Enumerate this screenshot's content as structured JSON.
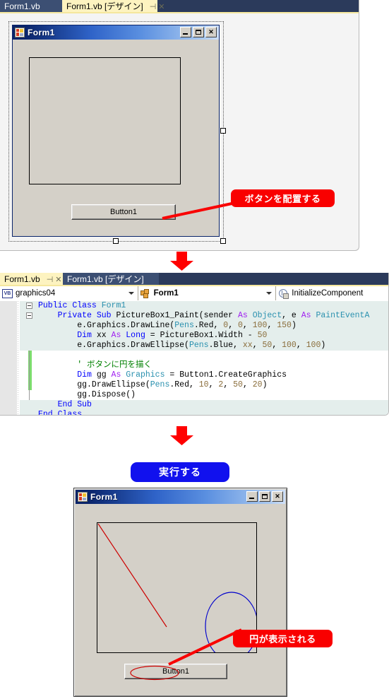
{
  "designer": {
    "tabs": [
      {
        "label": "Form1.vb",
        "active": false,
        "icons": []
      },
      {
        "label": "Form1.vb [デザイン]",
        "active": true,
        "icons": [
          "pin-icon",
          "close-icon"
        ]
      }
    ],
    "form": {
      "title": "Form1",
      "icon": "vb-form-icon",
      "window_buttons": [
        "minimize",
        "maximize",
        "close"
      ],
      "picturebox_name": "PictureBox1",
      "button_label": "Button1"
    },
    "callout": {
      "text": "ボタンを配置する",
      "color": "#f90000"
    }
  },
  "arrows": {
    "color": "#ff0000",
    "glyph": "down-arrow"
  },
  "editor": {
    "tabs": [
      {
        "label": "Form1.vb",
        "active": true,
        "icons": [
          "pin-icon",
          "close-icon"
        ]
      },
      {
        "label": "Form1.vb [デザイン]",
        "active": false,
        "icons": []
      }
    ],
    "dropdowns": [
      {
        "icon": "vb-project-icon",
        "icon_text": "VB",
        "value": "graphics04"
      },
      {
        "icon": "class-icon",
        "value": "Form1"
      },
      {
        "icon": "method-private-icon",
        "value": "InitializeComponent"
      }
    ],
    "code_lines": [
      {
        "indent": 0,
        "fold": "minus",
        "hl": true,
        "tokens": [
          {
            "t": "Public ",
            "c": "kw"
          },
          {
            "t": "Class ",
            "c": "kw"
          },
          {
            "t": "Form1",
            "c": "ty"
          }
        ]
      },
      {
        "indent": 1,
        "fold": "minus",
        "hl": true,
        "tokens": [
          {
            "t": "Private ",
            "c": "kw"
          },
          {
            "t": "Sub ",
            "c": "kw"
          },
          {
            "t": "PictureBox1_Paint(sender ",
            "c": "pl"
          },
          {
            "t": "As ",
            "c": "mod"
          },
          {
            "t": "Object",
            "c": "ty"
          },
          {
            "t": ", e ",
            "c": "pl"
          },
          {
            "t": "As ",
            "c": "mod"
          },
          {
            "t": "PaintEventA",
            "c": "ty"
          }
        ]
      },
      {
        "indent": 2,
        "fold": "",
        "hl": true,
        "tokens": [
          {
            "t": "e.Graphics.DrawLine(",
            "c": "pl"
          },
          {
            "t": "Pens",
            "c": "ty"
          },
          {
            "t": ".Red, ",
            "c": "pl"
          },
          {
            "t": "0",
            "c": "num"
          },
          {
            "t": ", ",
            "c": "pl"
          },
          {
            "t": "0",
            "c": "num"
          },
          {
            "t": ", ",
            "c": "pl"
          },
          {
            "t": "100",
            "c": "num"
          },
          {
            "t": ", ",
            "c": "pl"
          },
          {
            "t": "150",
            "c": "num"
          },
          {
            "t": ")",
            "c": "pl"
          }
        ]
      },
      {
        "indent": 2,
        "fold": "",
        "hl": true,
        "tokens": [
          {
            "t": "Dim ",
            "c": "kw"
          },
          {
            "t": "xx ",
            "c": "pl"
          },
          {
            "t": "As ",
            "c": "mod"
          },
          {
            "t": "Long",
            "c": "kw"
          },
          {
            "t": " = PictureBox1.Width - ",
            "c": "pl"
          },
          {
            "t": "50",
            "c": "num"
          }
        ]
      },
      {
        "indent": 2,
        "fold": "",
        "hl": true,
        "tokens": [
          {
            "t": "e.Graphics.DrawEllipse(",
            "c": "pl"
          },
          {
            "t": "Pens",
            "c": "ty"
          },
          {
            "t": ".Blue, ",
            "c": "pl"
          },
          {
            "t": "xx",
            "c": "num"
          },
          {
            "t": ", ",
            "c": "pl"
          },
          {
            "t": "50",
            "c": "num"
          },
          {
            "t": ", ",
            "c": "pl"
          },
          {
            "t": "100",
            "c": "num"
          },
          {
            "t": ", ",
            "c": "pl"
          },
          {
            "t": "100",
            "c": "num"
          },
          {
            "t": ")",
            "c": "pl"
          }
        ]
      },
      {
        "indent": 2,
        "fold": "",
        "hl": false,
        "tokens": []
      },
      {
        "indent": 2,
        "fold": "",
        "hl": false,
        "tokens": [
          {
            "t": "' ボタンに円を描く",
            "c": "cm"
          }
        ]
      },
      {
        "indent": 2,
        "fold": "",
        "hl": false,
        "tokens": [
          {
            "t": "Dim ",
            "c": "kw"
          },
          {
            "t": "gg ",
            "c": "pl"
          },
          {
            "t": "As ",
            "c": "mod"
          },
          {
            "t": "Graphics",
            "c": "ty"
          },
          {
            "t": " = Button1.CreateGraphics",
            "c": "pl"
          }
        ]
      },
      {
        "indent": 2,
        "fold": "",
        "hl": false,
        "tokens": [
          {
            "t": "gg.DrawEllipse(",
            "c": "pl"
          },
          {
            "t": "Pens",
            "c": "ty"
          },
          {
            "t": ".Red, ",
            "c": "pl"
          },
          {
            "t": "10",
            "c": "num"
          },
          {
            "t": ", ",
            "c": "pl"
          },
          {
            "t": "2",
            "c": "num"
          },
          {
            "t": ", ",
            "c": "pl"
          },
          {
            "t": "50",
            "c": "num"
          },
          {
            "t": ", ",
            "c": "pl"
          },
          {
            "t": "20",
            "c": "num"
          },
          {
            "t": ")",
            "c": "pl"
          }
        ]
      },
      {
        "indent": 2,
        "fold": "",
        "hl": false,
        "tokens": [
          {
            "t": "gg.Dispose()",
            "c": "pl"
          }
        ]
      },
      {
        "indent": 1,
        "fold": "",
        "hl": true,
        "tokens": [
          {
            "t": "End ",
            "c": "kw"
          },
          {
            "t": "Sub",
            "c": "kw"
          }
        ]
      },
      {
        "indent": 0,
        "fold": "",
        "hl": true,
        "tokens": [
          {
            "t": "End ",
            "c": "kw"
          },
          {
            "t": "Class",
            "c": "kw"
          }
        ]
      }
    ]
  },
  "run": {
    "button_label": "実行する",
    "button_color": "#1111ee",
    "form": {
      "title": "Form1",
      "button_label": "Button1",
      "line_color": "#cc0000",
      "ellipse_color": "#0000cc",
      "button_ellipse_color": "#cc0000"
    },
    "callout": {
      "text": "円が表示される",
      "color": "#f90000"
    }
  }
}
